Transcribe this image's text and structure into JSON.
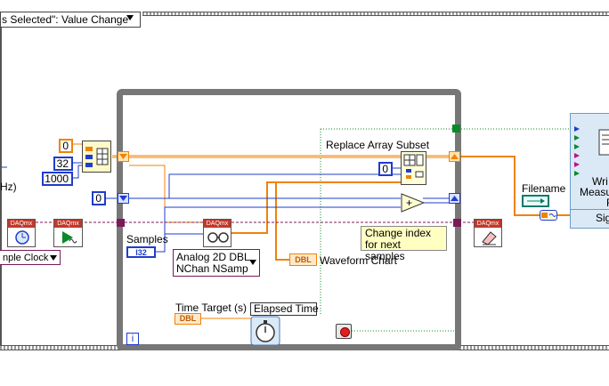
{
  "event_structure": {
    "case_selector": "s Selected\": Value Change"
  },
  "constants": {
    "c0_top": "0",
    "c32": "32",
    "c1000": "1000",
    "c0_loop_left": "0",
    "c0_replace": "0"
  },
  "left_labels": {
    "hz": "Hz)",
    "sample_clock": "nple Clock"
  },
  "daq_badge": "DAQmx",
  "loop": {
    "replace_array_subset": "Replace Array Subset",
    "samples": "Samples",
    "samples_type": "I32",
    "analog_read": {
      "line1": "Analog 2D DBL",
      "line2": "NChan NSamp"
    },
    "waveform_chart": "Waveform Chart",
    "waveform_chart_type": "DBL",
    "note": {
      "line1": "Change index",
      "line2": "for next samples"
    },
    "time_target": "Time Target (s)",
    "time_target_type": "DBL",
    "elapsed_time": "Elapsed Time",
    "iteration": "i"
  },
  "right_side": {
    "filename": "Filename",
    "subvi_text": {
      "line1": "Wri",
      "line2": "Measu",
      "line3": "F",
      "line4": "Sig"
    }
  },
  "colors": {
    "orange_wire": "#f0820a",
    "blue_wire": "#1f3ccd",
    "task_wire": "#7a1a5a",
    "boolean_wire": "#0a8a2a",
    "loop_border": "#777777"
  }
}
